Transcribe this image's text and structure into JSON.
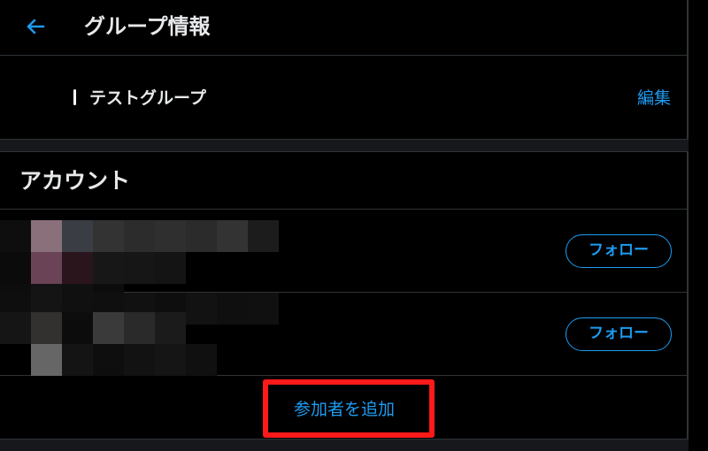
{
  "header": {
    "back_icon": "arrow-left-icon",
    "title": "グループ情報"
  },
  "group": {
    "name": "テストグループ",
    "edit_label": "編集"
  },
  "accounts_section": {
    "heading": "アカウント",
    "accounts": [
      {
        "follow_label": "フォロー"
      },
      {
        "follow_label": "フォロー"
      }
    ]
  },
  "add_participant": {
    "label": "参加者を追加"
  },
  "colors": {
    "accent": "#1d9bf0",
    "background": "#000000",
    "divider": "#2f3336",
    "band": "#16181c",
    "highlight": "#ff1a1a"
  }
}
